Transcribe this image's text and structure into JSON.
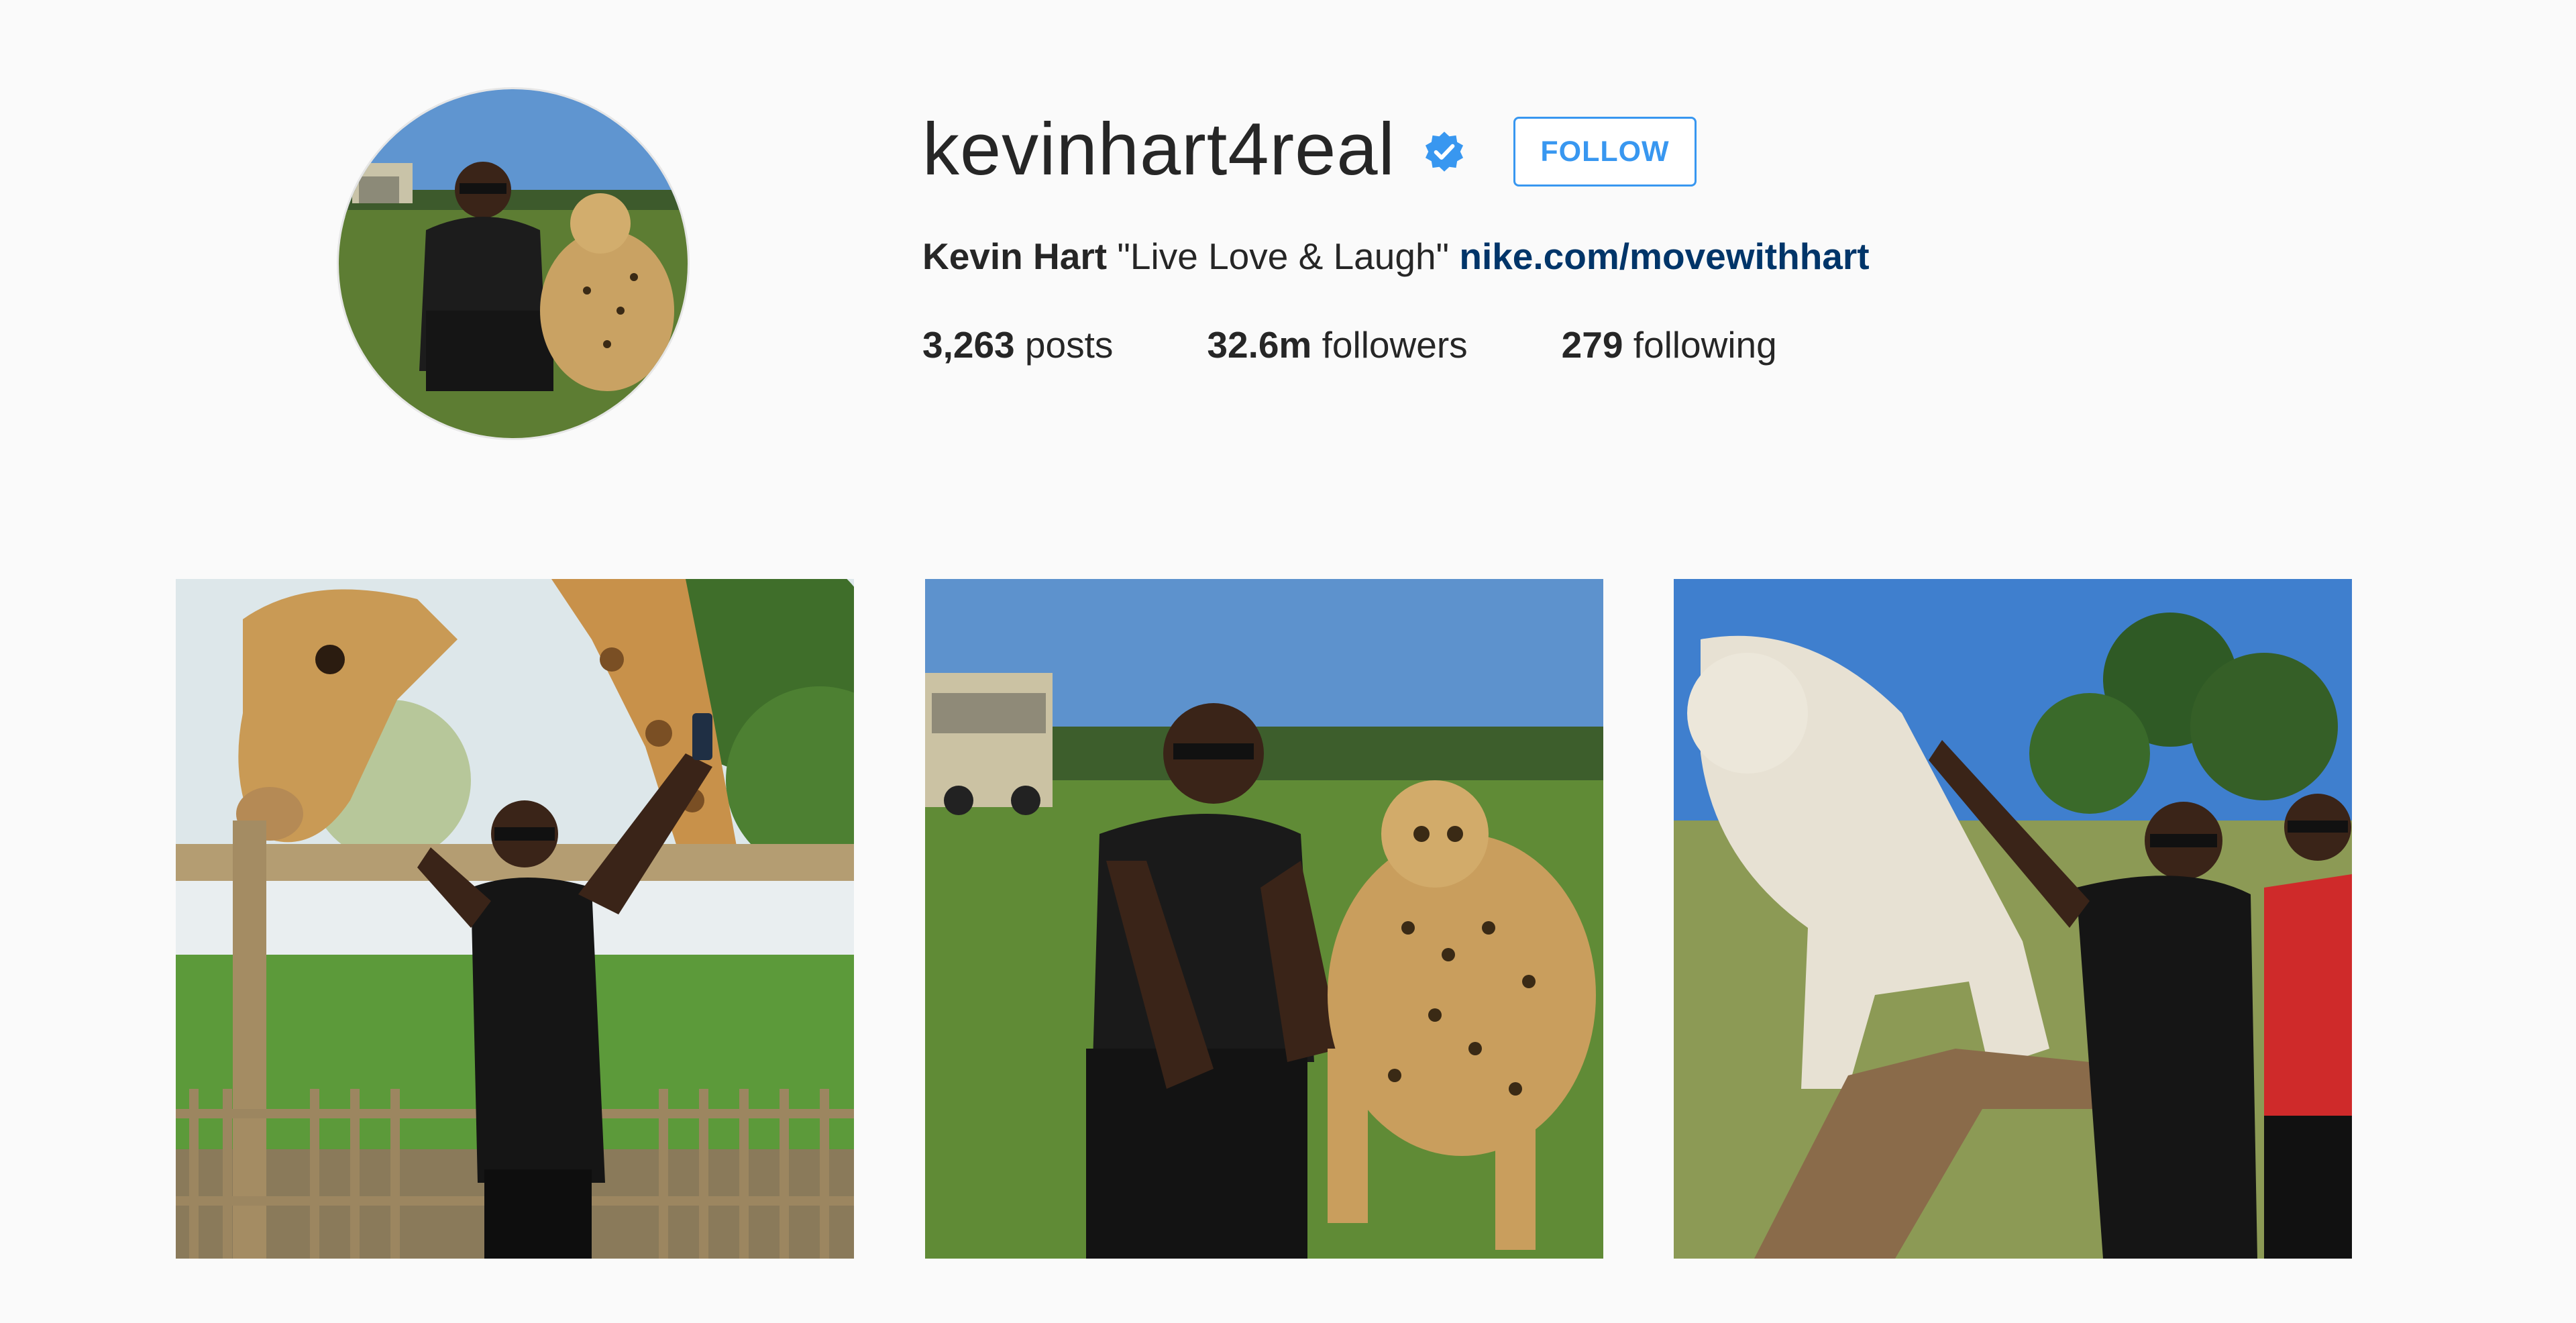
{
  "profile": {
    "username": "kevinhart4real",
    "verified": true,
    "follow_button_label": "FOLLOW",
    "full_name": "Kevin Hart",
    "bio_text": "\"Live Love & Laugh\"",
    "bio_link": "nike.com/movewithhart",
    "stats": {
      "posts_count": "3,263",
      "posts_label": "posts",
      "followers_count": "32.6m",
      "followers_label": "followers",
      "following_count": "279",
      "following_label": "following"
    }
  },
  "icons": {
    "verified_badge": "verified-check-icon"
  },
  "colors": {
    "background": "#fafafa",
    "accent_blue": "#3897f0",
    "link_blue": "#003569",
    "text": "#262626"
  },
  "grid": {
    "posts": [
      {
        "subject": "man taking a selfie with a giraffe"
      },
      {
        "subject": "man crouching beside a cheetah"
      },
      {
        "subject": "man and woman with a white lion"
      }
    ]
  }
}
